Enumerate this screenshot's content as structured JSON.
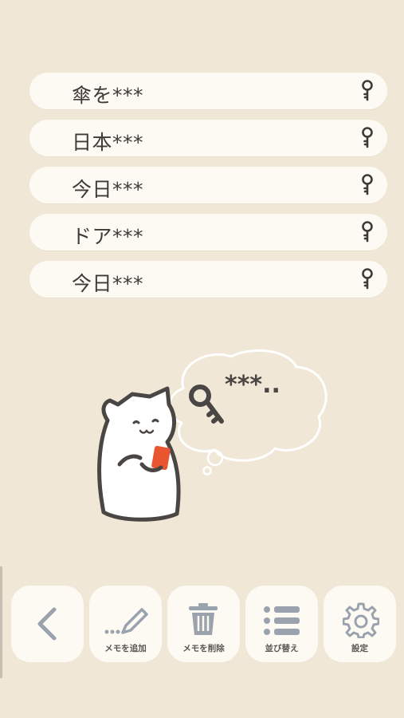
{
  "memos": [
    {
      "text": "傘を***",
      "icon": "key-icon"
    },
    {
      "text": "日本***",
      "icon": "key-icon"
    },
    {
      "text": "今日***",
      "icon": "key-icon"
    },
    {
      "text": "ドア***",
      "icon": "key-icon"
    },
    {
      "text": "今日***",
      "icon": "key-icon"
    }
  ],
  "illustration": {
    "bubble_text": "***..",
    "icons": [
      "cat-icon",
      "key-icon",
      "thought-bubble-icon"
    ]
  },
  "toolbar": {
    "back": {
      "label": "",
      "icon": "chevron-left-icon"
    },
    "add": {
      "label": "メモを追加",
      "icon": "pencil-icon"
    },
    "delete": {
      "label": "メモを削除",
      "icon": "trash-icon"
    },
    "sort": {
      "label": "並び替え",
      "icon": "list-icon"
    },
    "settings": {
      "label": "設定",
      "icon": "gear-icon"
    }
  },
  "colors": {
    "background": "#f1e7d7",
    "card": "#fdfaf4",
    "text": "#3f3a37",
    "icon_gray": "#9aa3ad",
    "phone_red": "#e8552f"
  }
}
